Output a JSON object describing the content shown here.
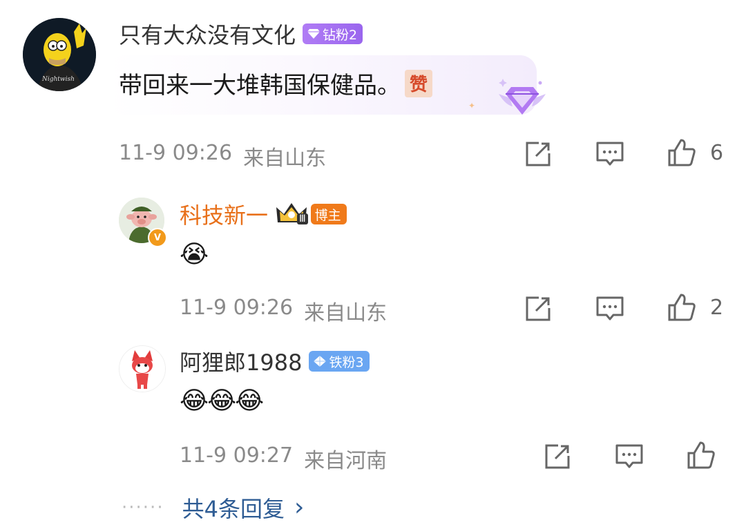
{
  "comments": [
    {
      "username": "只有大众没有文化",
      "badge": "钻粉2",
      "avatar_caption": "Nightwish",
      "text": "带回来一大堆韩国保健品。",
      "sticker": "赞",
      "time": "11-9 09:26",
      "location": "来自山东",
      "likes": "6"
    }
  ],
  "replies": [
    {
      "username": "科技新一",
      "rank_badge": "Ⅲ",
      "badge": "博主",
      "verified_mark": "V",
      "emoji": "😭",
      "time": "11-9 09:26",
      "location": "来自山东",
      "likes": "2"
    },
    {
      "username": "阿狸郎1988",
      "badge": "铁粉3",
      "emoji": "😂😂😂",
      "time": "11-9 09:27",
      "location": "来自河南",
      "likes": ""
    }
  ],
  "more_replies": {
    "dots": "······",
    "label": "共4条回复",
    "chevron": "›"
  },
  "icons": [
    "share-icon",
    "comment-icon",
    "like-icon",
    "diamond-badge-icon"
  ],
  "colors": {
    "owner_name": "#e8701a",
    "diamond_badge": "#a66cf0",
    "owner_badge": "#f07a1a",
    "iron_badge": "#6aa6f2",
    "link": "#2e5c94",
    "meta_gray": "#8a8a8a"
  }
}
